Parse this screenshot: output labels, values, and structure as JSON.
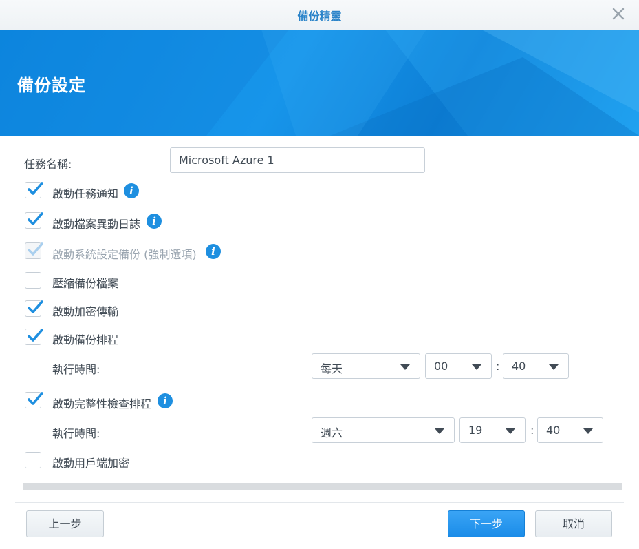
{
  "window": {
    "title": "備份精靈"
  },
  "banner": {
    "heading": "備份設定"
  },
  "task_name": {
    "label": "任務名稱:",
    "value": "Microsoft Azure 1"
  },
  "options": [
    {
      "label": "啟動任務通知",
      "checked": true,
      "disabled": false,
      "info": true
    },
    {
      "label": "啟動檔案異動日誌",
      "checked": true,
      "disabled": false,
      "info": true
    },
    {
      "label": "啟動系統設定備份 (強制選項)",
      "checked": true,
      "disabled": true,
      "info": true
    },
    {
      "label": "壓縮備份檔案",
      "checked": false,
      "disabled": false,
      "info": false
    },
    {
      "label": "啟動加密傳輸",
      "checked": true,
      "disabled": false,
      "info": false
    },
    {
      "label": "啟動備份排程",
      "checked": true,
      "disabled": false,
      "info": false
    },
    {
      "label": "啟動完整性檢查排程",
      "checked": true,
      "disabled": false,
      "info": true
    },
    {
      "label": "啟動用戶端加密",
      "checked": false,
      "disabled": false,
      "info": false
    }
  ],
  "backup_schedule": {
    "label": "執行時間:",
    "frequency": "每天",
    "hour": "00",
    "colon": ":",
    "minute": "40"
  },
  "integrity_schedule": {
    "label": "執行時間:",
    "frequency": "週六",
    "hour": "19",
    "colon": ":",
    "minute": "40"
  },
  "buttons": {
    "prev": "上一步",
    "next": "下一步",
    "cancel": "取消"
  },
  "colors": {
    "accent": "#1a8ce8",
    "banner": "#0b88e0",
    "title": "#2a83c9"
  },
  "icons": {
    "close": "close-icon",
    "check": "checkmark-icon",
    "info": "info-icon",
    "dropdown": "chevron-down-icon"
  }
}
